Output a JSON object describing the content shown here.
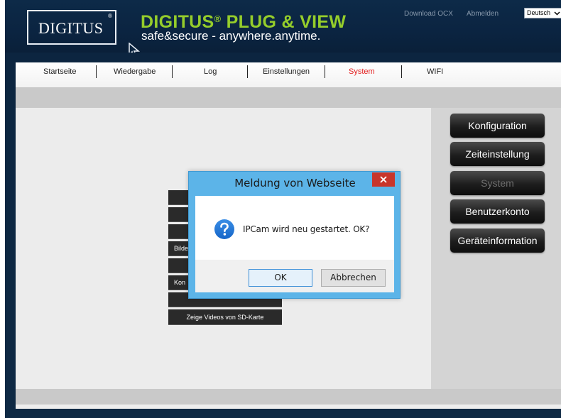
{
  "header": {
    "logo_text": "DIGITUS",
    "logo_reg": "®",
    "brand_title_a": "DIGITUS",
    "brand_title_reg": "®",
    "brand_title_b": " PLUG & VIEW",
    "brand_subtitle": "safe&secure - anywhere.anytime.",
    "download_link": "Download OCX",
    "logout_link": "Abmelden",
    "language": "Deutsch"
  },
  "nav": {
    "items": [
      {
        "label": "Startseite"
      },
      {
        "label": "Wiedergabe"
      },
      {
        "label": "Log"
      },
      {
        "label": "Einstellungen"
      },
      {
        "label": "System"
      },
      {
        "label": "WIFI"
      }
    ],
    "active": "System"
  },
  "background_buttons": [
    {
      "label": ""
    },
    {
      "label": ""
    },
    {
      "label": ""
    },
    {
      "label": "Bilde"
    },
    {
      "label": ""
    },
    {
      "label": "Kon"
    },
    {
      "label": ""
    },
    {
      "label": "Zeige Videos von SD-Karte"
    }
  ],
  "sidebar": {
    "items": [
      {
        "label": "Konfiguration"
      },
      {
        "label": "Zeiteinstellung"
      },
      {
        "label": "System"
      },
      {
        "label": "Benutzerkonto"
      },
      {
        "label": "Geräteinformation"
      }
    ],
    "selected": "System"
  },
  "dialog": {
    "title": "Meldung von Webseite",
    "message": "IPCam wird neu gestartet. OK?",
    "ok_label": "OK",
    "cancel_label": "Abbrechen"
  },
  "colors": {
    "header_bg": "#0c2540",
    "brand_green": "#95cd2b",
    "active_nav": "#e21b1b",
    "dialog_frame": "#5cb4e8",
    "close_button": "#c8352b"
  }
}
